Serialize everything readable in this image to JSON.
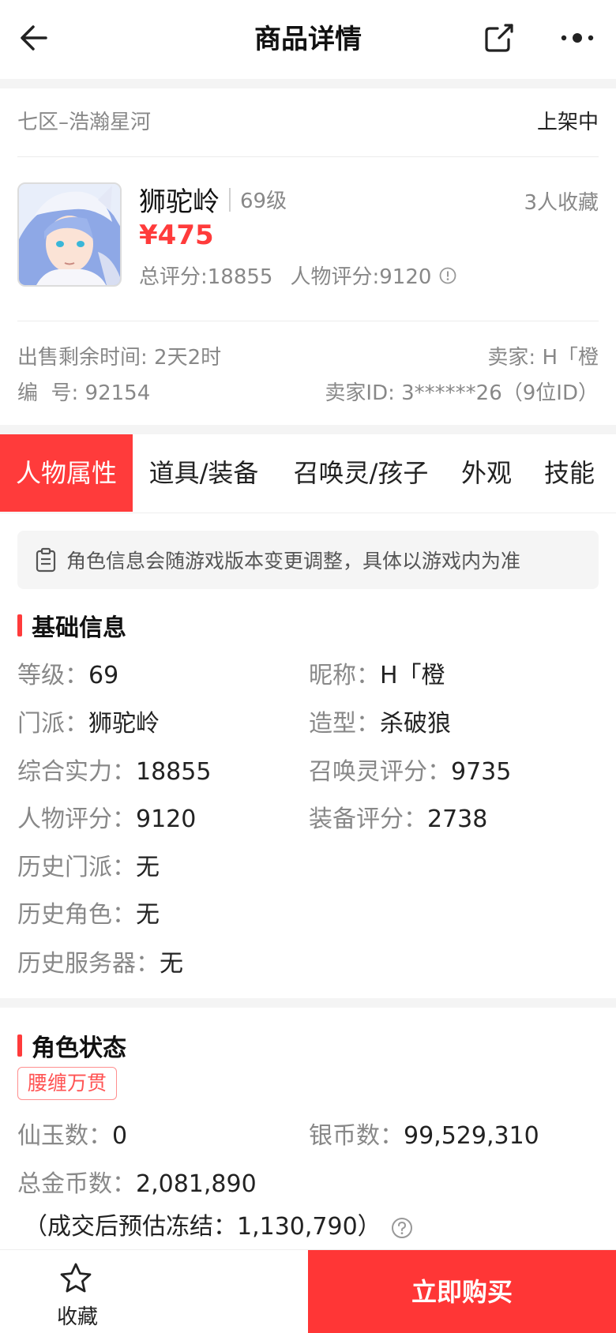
{
  "header": {
    "title": "商品详情",
    "back_icon": "back-arrow-icon",
    "share_icon": "share-icon",
    "more_icon": "more-icon"
  },
  "listing": {
    "server": "七区–浩瀚星河",
    "status": "上架中",
    "character_name": "狮驼岭",
    "level_label": "69级",
    "favorites": "3人收藏",
    "price": "¥475",
    "total_score": "总评分:18855",
    "char_score": "人物评分:9120",
    "remaining_time": "出售剩余时间: 2天2时",
    "seller": "卖家: H「橙",
    "serial": "编  号: 92154",
    "seller_id": "卖家ID: 3******26（9位ID）"
  },
  "tabs": [
    {
      "label": "人物属性",
      "active": true
    },
    {
      "label": "道具/装备",
      "active": false
    },
    {
      "label": "召唤灵/孩子",
      "active": false
    },
    {
      "label": "外观",
      "active": false
    },
    {
      "label": "技能",
      "active": false
    }
  ],
  "notice": "角色信息会随游戏版本变更调整，具体以游戏内为准",
  "basic_info": {
    "title": "基础信息",
    "items": [
      {
        "key": "等级：",
        "value": "69"
      },
      {
        "key": "昵称：",
        "value": "H「橙"
      },
      {
        "key": "门派：",
        "value": "狮驼岭"
      },
      {
        "key": "造型：",
        "value": "杀破狼"
      },
      {
        "key": "综合实力：",
        "value": "18855"
      },
      {
        "key": "召唤灵评分：",
        "value": "9735"
      },
      {
        "key": "人物评分：",
        "value": "9120"
      },
      {
        "key": "装备评分：",
        "value": "2738"
      },
      {
        "key": "历史门派：",
        "value": "无"
      },
      {
        "key": "历史角色：",
        "value": "无"
      },
      {
        "key": "历史服务器：",
        "value": "无"
      }
    ]
  },
  "role_status": {
    "title": "角色状态",
    "badge": "腰缠万贯",
    "items": [
      {
        "key": "仙玉数：",
        "value": "0"
      },
      {
        "key": "银币数：",
        "value": "99,529,310"
      },
      {
        "key": "总金币数：",
        "value": "2,081,890"
      }
    ],
    "frozen_note": "（成交后预估冻结：1,130,790）"
  },
  "bottom": {
    "favorite_label": "收藏",
    "buy_label": "立即购买"
  },
  "colors": {
    "accent": "#ff3b3b",
    "muted_text": "#888888",
    "background_gray": "#f4f4f4"
  }
}
